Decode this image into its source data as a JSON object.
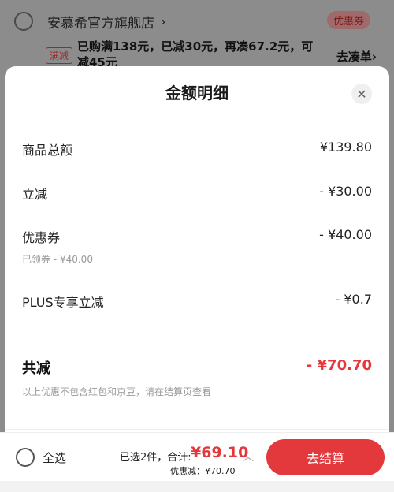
{
  "store": {
    "name": "安慕希官方旗舰店",
    "chevron": "›",
    "coupon_tag": "优惠券"
  },
  "promo": {
    "tag": "满减",
    "text": "已购满138元，已减30元，再凑67.2元，可减45元",
    "link": "去凑单›"
  },
  "sheet": {
    "title": "金额明细",
    "close_icon": "close-icon",
    "rows": [
      {
        "label": "商品总额",
        "value": "¥139.80"
      },
      {
        "label": "立减",
        "value": "- ¥30.00"
      },
      {
        "label": "优惠券",
        "value": "- ¥40.00",
        "sub": "已领券 - ¥40.00"
      },
      {
        "label": "PLUS专享立减",
        "value": "- ¥0.7"
      }
    ],
    "total": {
      "label": "共减",
      "value": "- ¥70.70"
    },
    "note": "以上优惠不包含红包和京豆，请在结算页查看"
  },
  "bottom_bar": {
    "select_all": "全选",
    "summary": "已选2件，合计:",
    "amount": "¥69.10",
    "discount": "优惠减：¥70.70",
    "checkout": "去结算"
  },
  "colors": {
    "accent": "#e4393c",
    "overlay": "#8c8c8c"
  }
}
